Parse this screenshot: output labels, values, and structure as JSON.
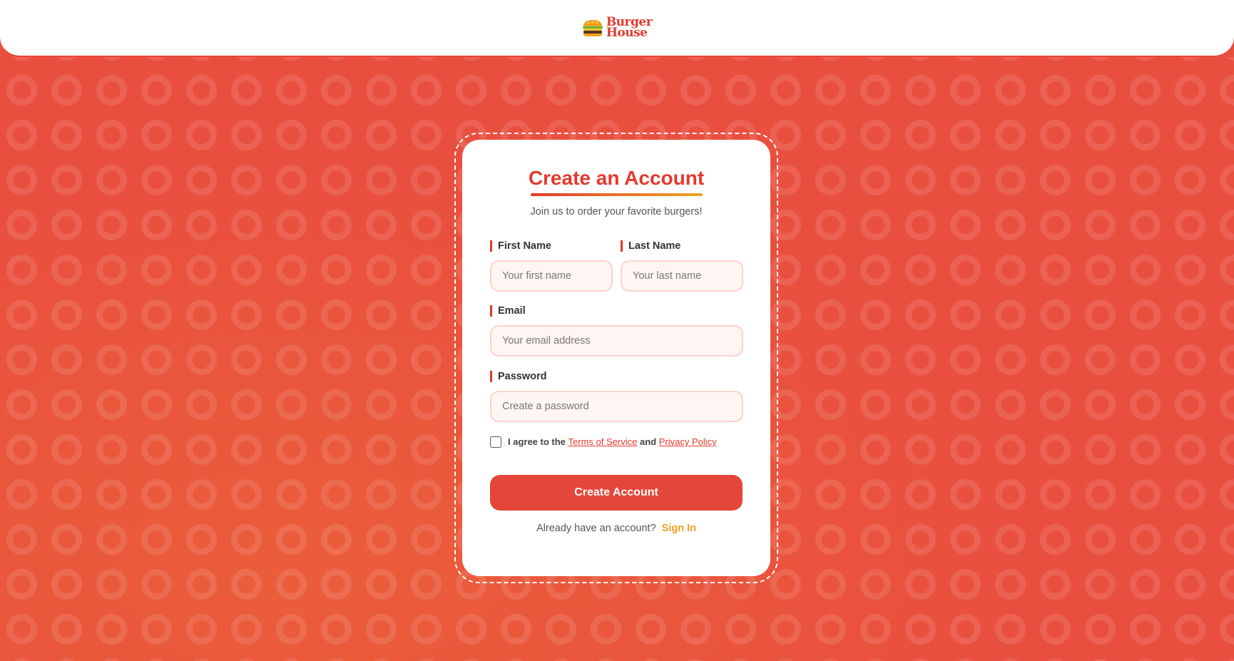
{
  "brand": {
    "name_line1": "Burger",
    "name_line2": "House",
    "icon": "burger-icon",
    "color": "#e4392c"
  },
  "form": {
    "title": "Create an Account",
    "subtitle": "Join us to order your favorite burgers!",
    "first_name_label": "First Name",
    "first_name_placeholder": "Your first name",
    "first_name_value": "",
    "last_name_label": "Last Name",
    "last_name_placeholder": "Your last name",
    "last_name_value": "",
    "email_label": "Email",
    "email_placeholder": "Your email address",
    "email_value": "",
    "password_label": "Password",
    "password_placeholder": "Create a password",
    "password_value": "",
    "agree_prefix": "I agree to the",
    "terms_link": "Terms of Service",
    "agree_and": "and",
    "privacy_link": "Privacy Policy",
    "agree_checked": false,
    "submit_label": "Create Account",
    "signin_prompt": "Already have an account?",
    "signin_link": "Sign In"
  },
  "colors": {
    "background": "#e94f3f",
    "accent": "#e4392c",
    "link_accent": "#f0a020",
    "input_bg": "#fff5f3"
  }
}
